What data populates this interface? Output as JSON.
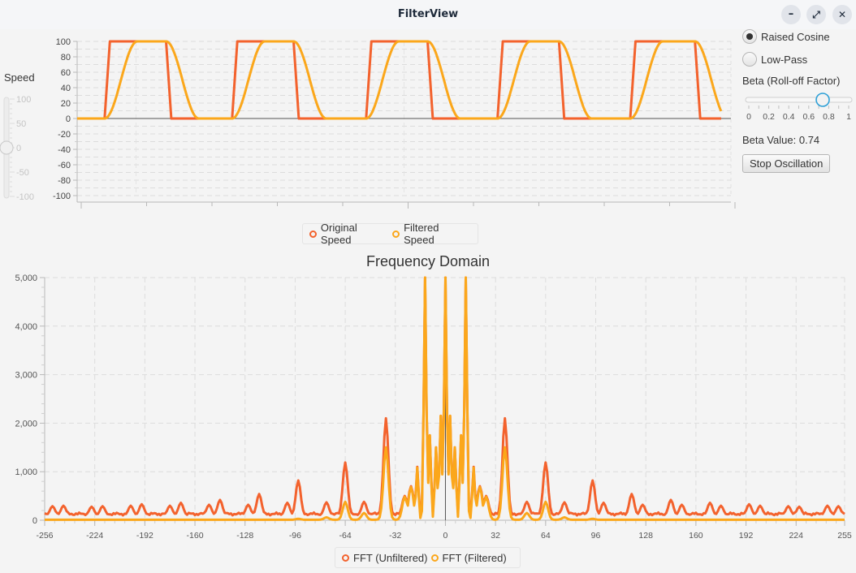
{
  "window": {
    "title": "FilterView",
    "buttons": [
      {
        "name": "minimize",
        "glyph": "–"
      },
      {
        "name": "maximize",
        "glyph": "⤢"
      },
      {
        "name": "close",
        "glyph": "✕"
      }
    ]
  },
  "speed_slider": {
    "label": "Speed",
    "ticks": [
      "100",
      "50",
      "0",
      "-50",
      "-100"
    ],
    "min": -100,
    "max": 100,
    "value": 0
  },
  "controls": {
    "filter_options": [
      {
        "label": "Raised Cosine",
        "selected": true
      },
      {
        "label": "Low-Pass",
        "selected": false
      }
    ],
    "beta_label": "Beta (Roll-off Factor)",
    "beta_ticks": [
      "0",
      "0.2",
      "0.4",
      "0.6",
      "0.8",
      "1"
    ],
    "beta_min": 0,
    "beta_max": 1,
    "beta_value": 0.74,
    "beta_value_text": "Beta Value: 0.74",
    "stop_button": "Stop Oscillation"
  },
  "colors": {
    "original": "#f3622d",
    "filtered": "#fba71b",
    "grid": "#dcdcdc",
    "axis": "#b8b8b8",
    "zero": "#555555"
  },
  "chart_data": [
    {
      "type": "line",
      "title": "",
      "xlabel": "",
      "ylabel": "",
      "ylim": [
        -100,
        100
      ],
      "yticks": [
        "100",
        "80",
        "60",
        "40",
        "20",
        "0",
        "-20",
        "-40",
        "-60",
        "-80",
        "-100"
      ],
      "grid": true,
      "legend_position": "bottom",
      "description": "Square wave oscillating 0-100 with 5 pulses; filtered version has raised-cosine transitions",
      "pulses": [
        {
          "rise": 0.042,
          "fall": 0.136
        },
        {
          "rise": 0.237,
          "fall": 0.331
        },
        {
          "rise": 0.442,
          "fall": 0.536
        },
        {
          "rise": 0.643,
          "fall": 0.737
        },
        {
          "rise": 0.846,
          "fall": 0.945
        }
      ],
      "x_fraction_range": [
        0,
        1
      ],
      "series": [
        {
          "name": "Original Speed",
          "low": 0,
          "high": 100
        },
        {
          "name": "Filtered Speed",
          "low": 0,
          "high": 100,
          "transition_fraction": 0.05
        }
      ]
    },
    {
      "type": "line",
      "title": "Frequency Domain",
      "xlabel": "",
      "ylabel": "",
      "xlim": [
        -256,
        255
      ],
      "ylim": [
        0,
        5000
      ],
      "xticks": [
        "-256",
        "-224",
        "-192",
        "-160",
        "-128",
        "-96",
        "-64",
        "-32",
        "0",
        "32",
        "64",
        "96",
        "128",
        "160",
        "192",
        "224",
        "255"
      ],
      "yticks": [
        "5,000",
        "4,000",
        "3,000",
        "2,000",
        "1,000",
        "0"
      ],
      "grid": true,
      "legend_position": "bottom",
      "series": [
        {
          "name": "FFT (Unfiltered)",
          "baseline": 100,
          "peaks": [
            {
              "x": -251,
              "y": 290
            },
            {
              "x": -244,
              "y": 300
            },
            {
              "x": -226,
              "y": 280
            },
            {
              "x": -219,
              "y": 290
            },
            {
              "x": -201,
              "y": 300
            },
            {
              "x": -194,
              "y": 330
            },
            {
              "x": -176,
              "y": 300
            },
            {
              "x": -169,
              "y": 360
            },
            {
              "x": -151,
              "y": 320
            },
            {
              "x": -144,
              "y": 420
            },
            {
              "x": -126,
              "y": 320
            },
            {
              "x": -119,
              "y": 540
            },
            {
              "x": -101,
              "y": 360
            },
            {
              "x": -94,
              "y": 820
            },
            {
              "x": -76,
              "y": 370
            },
            {
              "x": -64,
              "y": 1190
            },
            {
              "x": -52,
              "y": 380
            },
            {
              "x": -38,
              "y": 2100
            },
            {
              "x": -26,
              "y": 500
            },
            {
              "x": -22,
              "y": 700
            },
            {
              "x": -18,
              "y": 1100
            },
            {
              "x": -13,
              "y": 5000
            },
            {
              "x": -10,
              "y": 1750
            },
            {
              "x": -6,
              "y": 1500
            },
            {
              "x": -3,
              "y": 2150
            },
            {
              "x": 0,
              "y": 5000
            },
            {
              "x": 3,
              "y": 2150
            },
            {
              "x": 6,
              "y": 1500
            },
            {
              "x": 10,
              "y": 1750
            },
            {
              "x": 13,
              "y": 5000
            },
            {
              "x": 18,
              "y": 1100
            },
            {
              "x": 22,
              "y": 700
            },
            {
              "x": 26,
              "y": 500
            },
            {
              "x": 38,
              "y": 2100
            },
            {
              "x": 52,
              "y": 380
            },
            {
              "x": 64,
              "y": 1190
            },
            {
              "x": 76,
              "y": 370
            },
            {
              "x": 94,
              "y": 820
            },
            {
              "x": 101,
              "y": 360
            },
            {
              "x": 119,
              "y": 540
            },
            {
              "x": 126,
              "y": 320
            },
            {
              "x": 144,
              "y": 420
            },
            {
              "x": 151,
              "y": 320
            },
            {
              "x": 169,
              "y": 360
            },
            {
              "x": 176,
              "y": 300
            },
            {
              "x": 194,
              "y": 330
            },
            {
              "x": 201,
              "y": 300
            },
            {
              "x": 219,
              "y": 290
            },
            {
              "x": 226,
              "y": 280
            },
            {
              "x": 244,
              "y": 300
            },
            {
              "x": 251,
              "y": 290
            }
          ]
        },
        {
          "name": "FFT (Filtered)",
          "baseline": 10,
          "peaks": [
            {
              "x": -94,
              "y": 30
            },
            {
              "x": -76,
              "y": 60
            },
            {
              "x": -64,
              "y": 380
            },
            {
              "x": -52,
              "y": 150
            },
            {
              "x": -38,
              "y": 1500
            },
            {
              "x": -26,
              "y": 480
            },
            {
              "x": -22,
              "y": 680
            },
            {
              "x": -18,
              "y": 1080
            },
            {
              "x": -13,
              "y": 5000
            },
            {
              "x": -10,
              "y": 1750
            },
            {
              "x": -6,
              "y": 1500
            },
            {
              "x": -3,
              "y": 2150
            },
            {
              "x": 0,
              "y": 5000
            },
            {
              "x": 3,
              "y": 2150
            },
            {
              "x": 6,
              "y": 1500
            },
            {
              "x": 10,
              "y": 1750
            },
            {
              "x": 13,
              "y": 5000
            },
            {
              "x": 18,
              "y": 1080
            },
            {
              "x": 22,
              "y": 680
            },
            {
              "x": 26,
              "y": 480
            },
            {
              "x": 38,
              "y": 1500
            },
            {
              "x": 52,
              "y": 150
            },
            {
              "x": 64,
              "y": 380
            },
            {
              "x": 76,
              "y": 60
            },
            {
              "x": 94,
              "y": 30
            }
          ]
        }
      ]
    }
  ],
  "legends": {
    "time": [
      "Original Speed",
      "Filtered Speed"
    ],
    "freq": [
      "FFT (Unfiltered)",
      "FFT (Filtered)"
    ]
  }
}
